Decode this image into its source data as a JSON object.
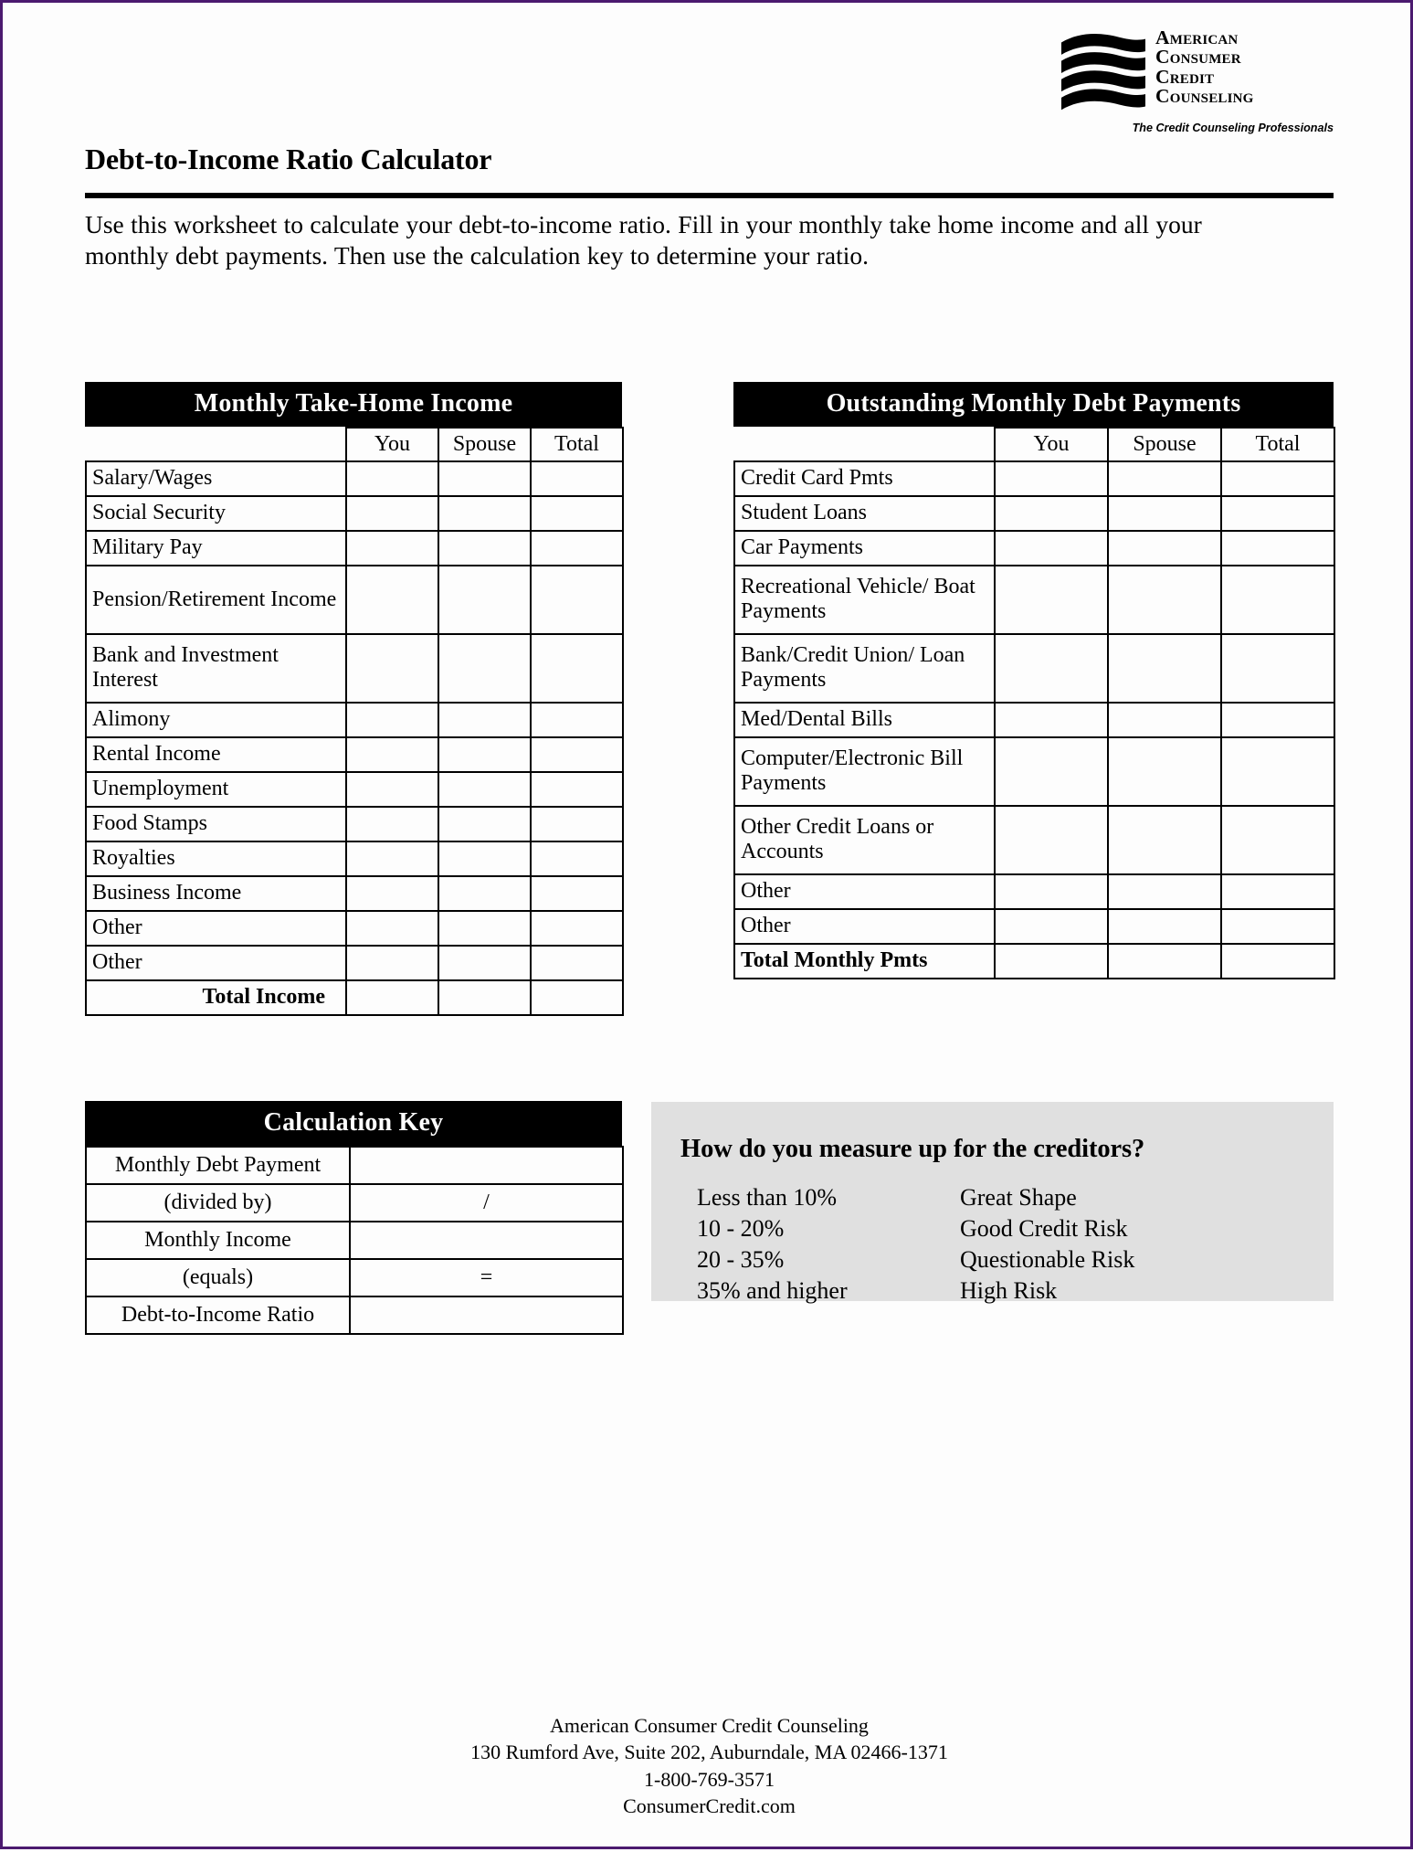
{
  "page": {
    "border_color": "#4b1a6f",
    "background": "#ffffff"
  },
  "logo": {
    "line1": "American",
    "line2": "Consumer",
    "line3": "Credit",
    "line4": "Counseling",
    "tagline": "The Credit Counseling Professionals",
    "mark": "wavy-flag-icon"
  },
  "header": {
    "title": "Debt-to-Income Ratio Calculator",
    "intro": "Use this worksheet to calculate your debt-to-income ratio.  Fill in your monthly take home income and all your monthly debt payments.  Then use the calculation key to determine your ratio."
  },
  "income": {
    "heading": "Monthly Take-Home Income",
    "columns": [
      "You",
      "Spouse",
      "Total"
    ],
    "rows": [
      {
        "label": "Salary/Wages",
        "tall": false
      },
      {
        "label": "Social Security",
        "tall": false
      },
      {
        "label": "Military Pay",
        "tall": false
      },
      {
        "label": "Pension/Retirement Income",
        "tall": true
      },
      {
        "label": "Bank and Investment Interest",
        "tall": true
      },
      {
        "label": "Alimony",
        "tall": false
      },
      {
        "label": "Rental Income",
        "tall": false
      },
      {
        "label": "Unemployment",
        "tall": false
      },
      {
        "label": "Food Stamps",
        "tall": false
      },
      {
        "label": "Royalties",
        "tall": false
      },
      {
        "label": "Business Income",
        "tall": false
      },
      {
        "label": "Other",
        "tall": false
      },
      {
        "label": "Other",
        "tall": false
      }
    ],
    "total_label": "Total Income"
  },
  "debt": {
    "heading": "Outstanding Monthly Debt Payments",
    "columns": [
      "You",
      "Spouse",
      "Total"
    ],
    "rows": [
      {
        "label": "Credit Card Pmts",
        "tall": false
      },
      {
        "label": "Student Loans",
        "tall": false
      },
      {
        "label": "Car Payments",
        "tall": false
      },
      {
        "label": "Recreational Vehicle/ Boat Payments",
        "tall": true
      },
      {
        "label": "Bank/Credit Union/ Loan Payments",
        "tall": true
      },
      {
        "label": "Med/Dental Bills",
        "tall": false
      },
      {
        "label": "Computer/Electronic Bill Payments",
        "tall": true
      },
      {
        "label": "Other Credit Loans or Accounts",
        "tall": true
      },
      {
        "label": "Other",
        "tall": false
      },
      {
        "label": "Other",
        "tall": false
      }
    ],
    "total_label": "Total Monthly Pmts"
  },
  "calc_key": {
    "heading": "Calculation Key",
    "rows": [
      {
        "label": "Monthly Debt Payment",
        "value": ""
      },
      {
        "label": "(divided by)",
        "value": "/"
      },
      {
        "label": "Monthly Income",
        "value": ""
      },
      {
        "label": "(equals)",
        "value": "="
      },
      {
        "label": "Debt-to-Income Ratio",
        "value": ""
      }
    ]
  },
  "measure_up": {
    "heading": "How do you measure up for the creditors?",
    "rows": [
      {
        "range": "Less than 10%",
        "risk": "Great Shape"
      },
      {
        "range": "10 - 20%",
        "risk": "Good Credit Risk"
      },
      {
        "range": "20 - 35%",
        "risk": "Questionable Risk"
      },
      {
        "range": "35% and higher",
        "risk": "High Risk"
      }
    ],
    "background": "#e0e0e0"
  },
  "footer": {
    "line1": "American Consumer Credit Counseling",
    "line2": "130 Rumford Ave, Suite 202, Auburndale, MA 02466-1371",
    "line3": "1-800-769-3571",
    "line4": "ConsumerCredit.com"
  }
}
